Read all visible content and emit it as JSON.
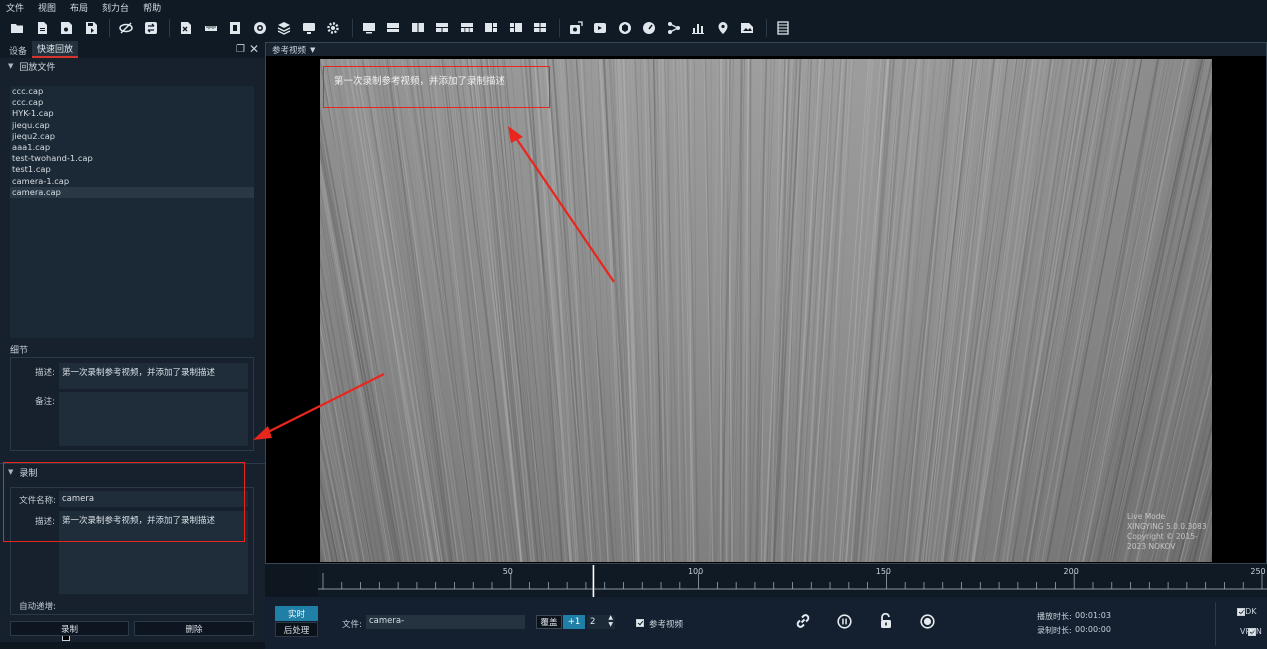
{
  "menu": [
    "文件",
    "视图",
    "布局",
    "刻力台",
    "帮助"
  ],
  "panel_tabs": [
    "设备",
    "快速回放"
  ],
  "playback_section": {
    "title": "回放文件",
    "files": [
      "ccc.cap",
      "ccc.cap",
      "HYK-1.cap",
      "jiequ.cap",
      "jiequ2.cap",
      "aaa1.cap",
      "test-twohand-1.cap",
      "test1.cap",
      "camera-1.cap",
      "camera.cap"
    ],
    "selected_index": 9
  },
  "details": {
    "title": "细节",
    "desc_label": "描述:",
    "desc_value": "第一次录制参考视频，并添加了录制描述",
    "note_label": "备注:",
    "note_value": ""
  },
  "record": {
    "title": "录制",
    "filename_label": "文件名称:",
    "filename_value": "camera",
    "desc_label": "描述:",
    "desc_value": "第一次录制参考视频，并添加了录制描述",
    "auto_label": "自动递增:",
    "auto_checked": false,
    "record_button": "录制",
    "delete_button": "删除"
  },
  "video": {
    "header": "参考视频",
    "overlay_text": "第一次录制参考视频，并添加了录制描述",
    "watermark": [
      "Live Mode",
      "XINGYING 5.0.0.3083",
      "Copyright © 2015-2023 NOKOV"
    ]
  },
  "timeline": {
    "labels": [
      "50",
      "100",
      "150",
      "200",
      "250"
    ],
    "position": 72
  },
  "bottom": {
    "mode_realtime": "实时",
    "mode_post": "后处理",
    "file_label": "文件:",
    "file_value": "camera-",
    "overwrite": "覆盖",
    "plus_one": "+1",
    "stepper_value": "2",
    "ref_video_label": "参考视频",
    "ref_video_checked": true,
    "play_duration_label": "播放时长:",
    "play_duration_value": "00:01:03",
    "record_duration_label": "录制时长:",
    "record_duration_value": "00:00:00",
    "sdk_label": "SDK",
    "vrpn_label": "VRPN",
    "sdk_checked": true,
    "vrpn_checked": true
  },
  "colors": {
    "accent": "#1f7fa6",
    "annotation": "#e8261d"
  }
}
